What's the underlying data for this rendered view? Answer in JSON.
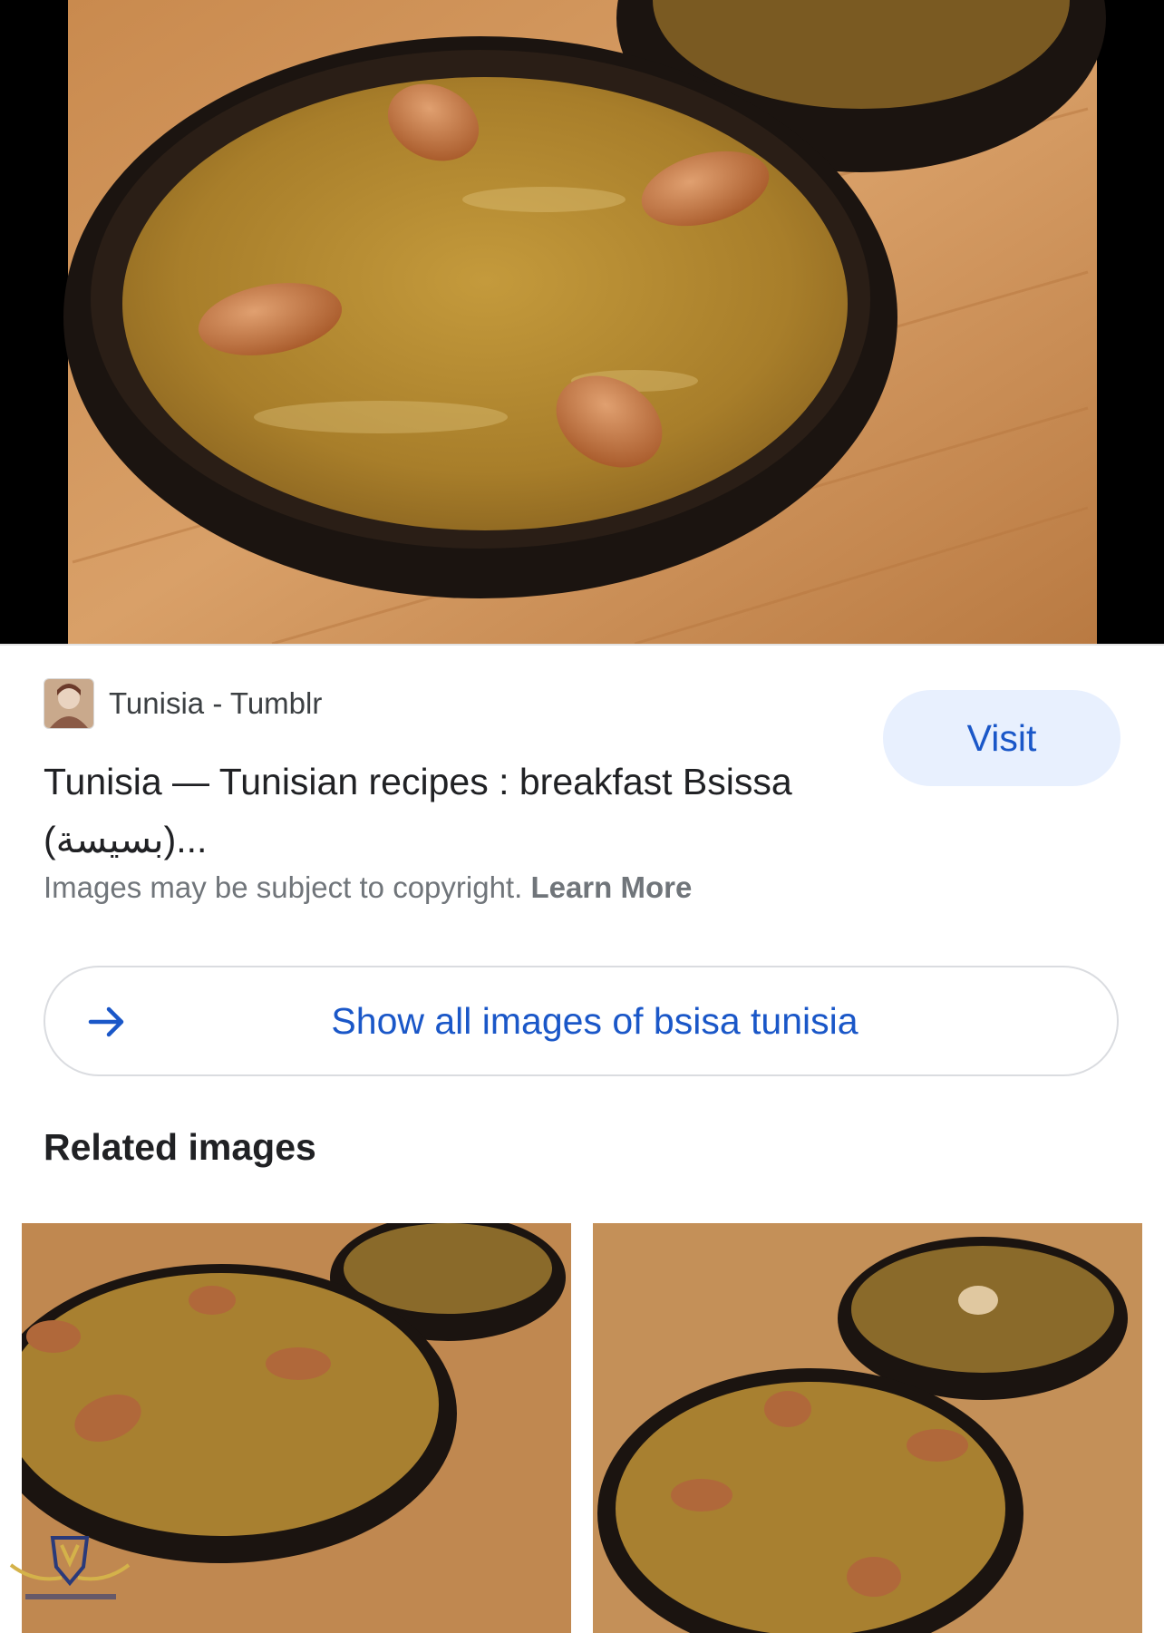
{
  "source": {
    "name": "Tunisia - Tumblr",
    "favicon_icon": "user-avatar-icon"
  },
  "result": {
    "title": "Tunisia — Tunisian recipes : breakfast Bsissa (بسيسة)..."
  },
  "visit_button": {
    "label": "Visit"
  },
  "copyright": {
    "text": "Images may be subject to copyright.",
    "learn_more": "Learn More"
  },
  "show_all": {
    "label": "Show all images of bsisa tunisia",
    "icon": "arrow-right-icon"
  },
  "related": {
    "heading": "Related images"
  },
  "colors": {
    "accent_blue": "#1a57c8",
    "visit_bg": "#e8f0fe",
    "text_secondary": "#70757a",
    "text_primary": "#202124"
  }
}
